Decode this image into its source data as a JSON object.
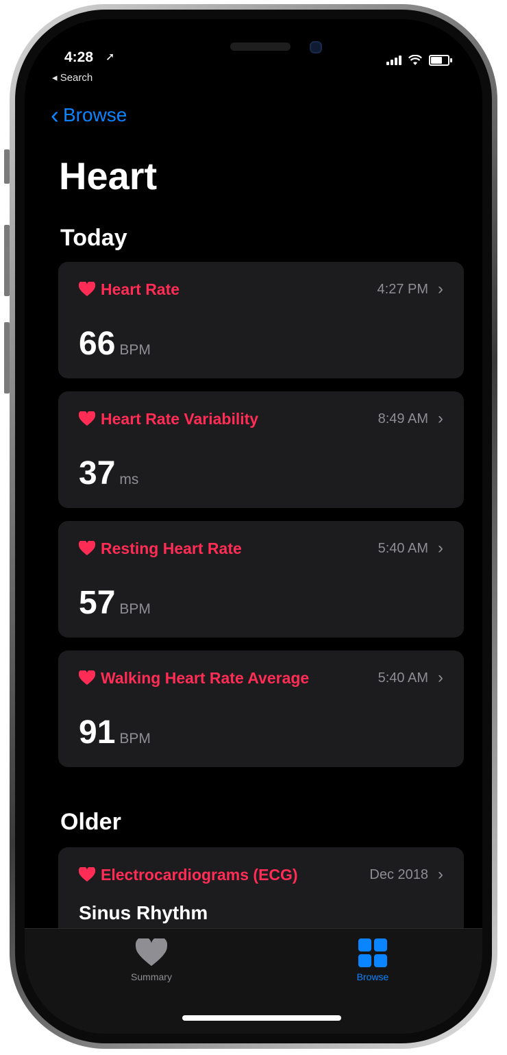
{
  "status_bar": {
    "time": "4:28",
    "back_label": "◂ Search"
  },
  "nav": {
    "back_label": "Browse"
  },
  "page": {
    "title": "Heart"
  },
  "sections": {
    "today": "Today",
    "older": "Older"
  },
  "cards": [
    {
      "label": "Heart Rate",
      "time": "4:27 PM",
      "value": "66",
      "unit": "BPM"
    },
    {
      "label": "Heart Rate Variability",
      "time": "8:49 AM",
      "value": "37",
      "unit": "ms"
    },
    {
      "label": "Resting Heart Rate",
      "time": "5:40 AM",
      "value": "57",
      "unit": "BPM"
    },
    {
      "label": "Walking Heart Rate Average",
      "time": "5:40 AM",
      "value": "91",
      "unit": "BPM"
    }
  ],
  "older_card": {
    "label": "Electrocardiograms (ECG)",
    "time": "Dec 2018",
    "value": "Sinus Rhythm"
  },
  "tab_bar": {
    "summary": {
      "label": "Summary",
      "icon": "heart-icon"
    },
    "browse": {
      "label": "Browse",
      "icon": "grid-icon"
    }
  },
  "colors": {
    "accent": "#0a84ff",
    "heart": "#ff2d55",
    "card_bg": "#1c1c1e",
    "secondary_text": "#8e8e93"
  }
}
